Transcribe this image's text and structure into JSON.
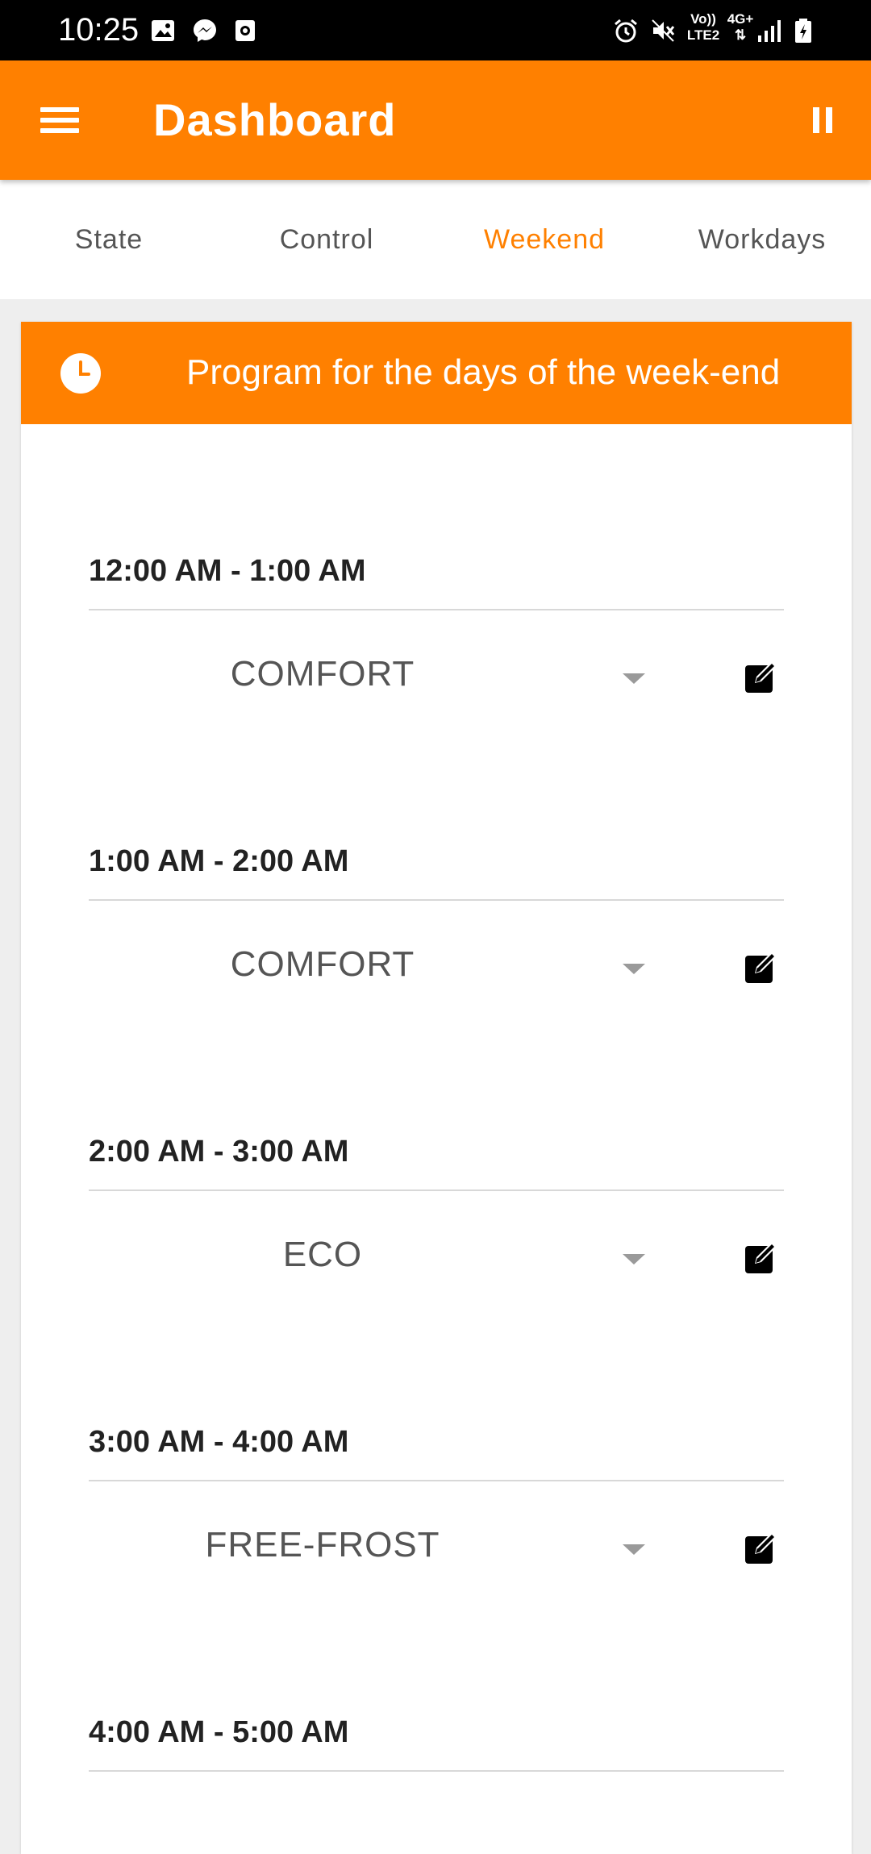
{
  "status_bar": {
    "time": "10:25",
    "left_icons": [
      "gallery-icon",
      "messenger-icon",
      "camera-icon"
    ],
    "network_label_top": "Vo))",
    "network_label_bottom": "LTE2",
    "network_type": "4G+",
    "right_icons": [
      "alarm-icon",
      "mute-icon",
      "signal-icon",
      "battery-icon"
    ]
  },
  "appbar": {
    "title": "Dashboard",
    "menu_icon": "hamburger-menu-icon",
    "action_icon": "pause-icon"
  },
  "tabs": [
    {
      "label": "State",
      "active": false
    },
    {
      "label": "Control",
      "active": false
    },
    {
      "label": "Weekend",
      "active": true
    },
    {
      "label": "Workdays",
      "active": false
    }
  ],
  "card": {
    "icon": "clock-icon",
    "title": "Program for the days of the week-end",
    "slots": [
      {
        "time": "12:00 AM - 1:00 AM",
        "mode": "COMFORT"
      },
      {
        "time": "1:00 AM - 2:00 AM",
        "mode": "COMFORT"
      },
      {
        "time": "2:00 AM - 3:00 AM",
        "mode": "ECO"
      },
      {
        "time": "3:00 AM - 4:00 AM",
        "mode": "FREE-FROST"
      },
      {
        "time": "4:00 AM - 5:00 AM",
        "mode": ""
      }
    ]
  },
  "colors": {
    "primary": "#ff8000",
    "status_bar": "#000000",
    "background": "#eeeeee",
    "tab_text": "#555555"
  }
}
